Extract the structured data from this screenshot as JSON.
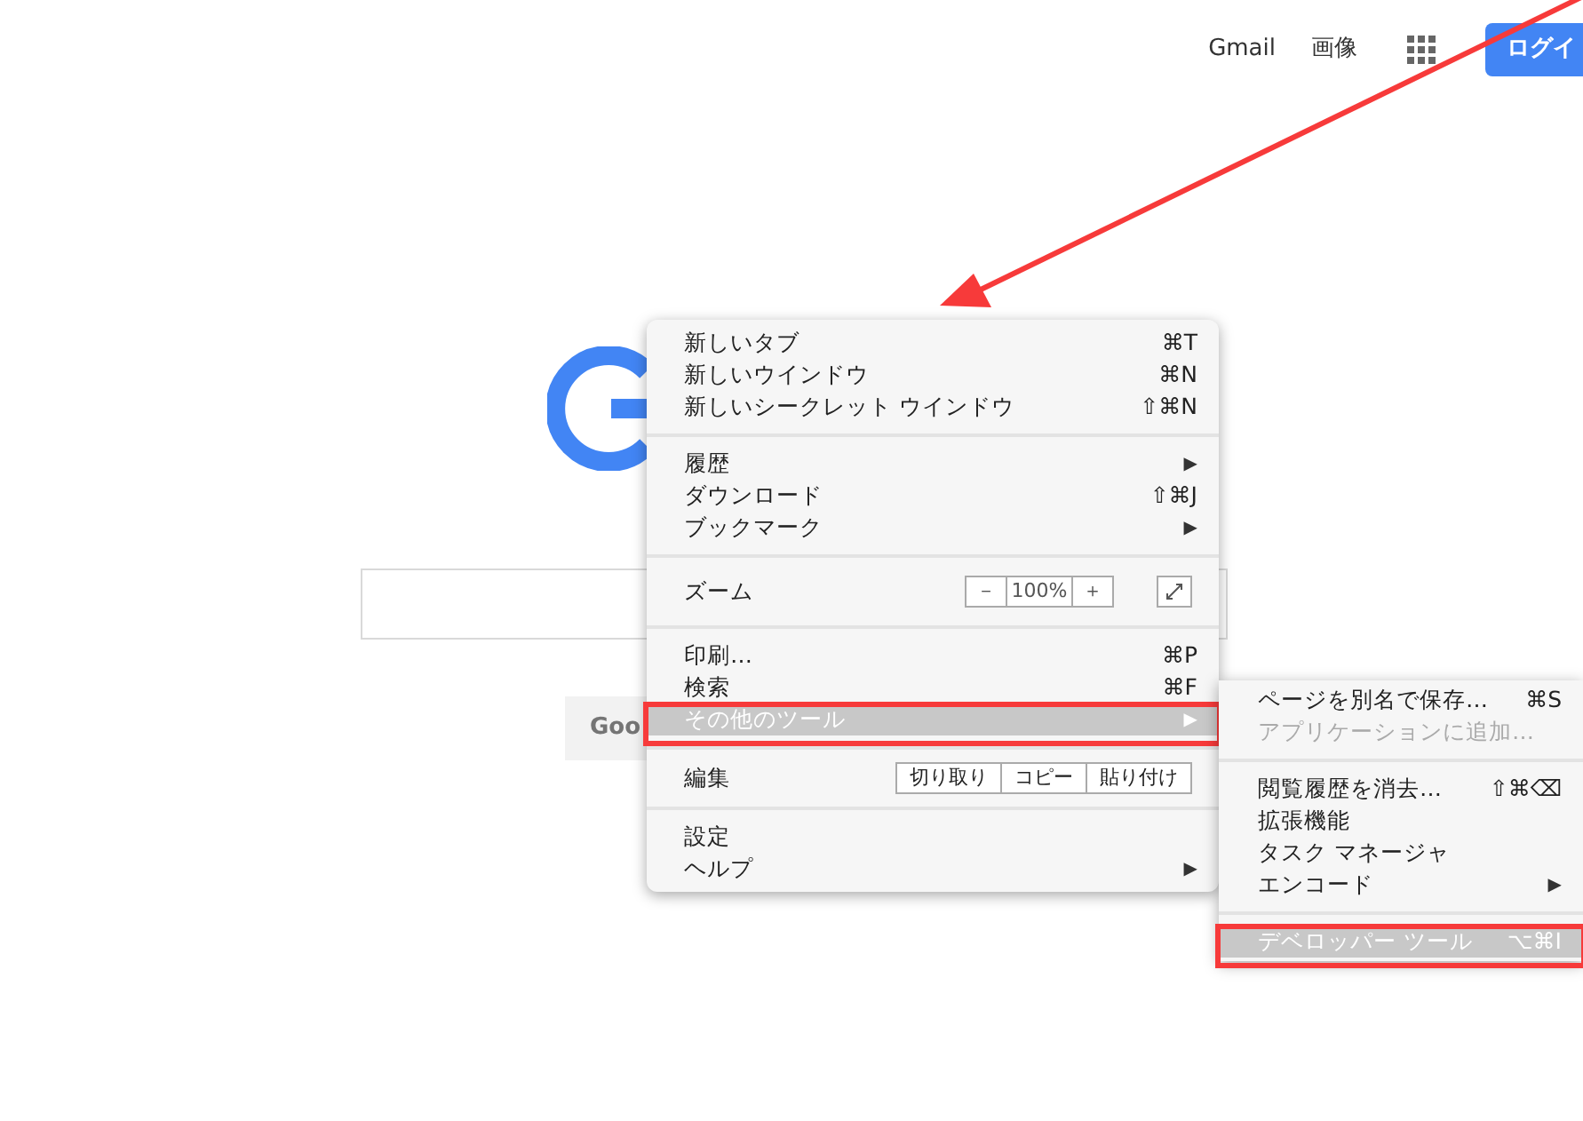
{
  "header": {
    "links": [
      "Gmail",
      "画像"
    ],
    "login_button": "ログイ"
  },
  "search": {
    "button": "Goo"
  },
  "menu": {
    "items": [
      {
        "kind": "item",
        "label": "新しいタブ",
        "shortcut": "⌘T",
        "selected": false
      },
      {
        "kind": "item",
        "label": "新しいウインドウ",
        "shortcut": "⌘N",
        "selected": false
      },
      {
        "kind": "item",
        "label": "新しいシークレット ウインドウ",
        "shortcut": "⇧⌘N",
        "selected": false
      },
      {
        "kind": "separator"
      },
      {
        "kind": "item",
        "label": "履歴",
        "arrow": "▶",
        "selected": false
      },
      {
        "kind": "item",
        "label": "ダウンロード",
        "shortcut": "⇧⌘J",
        "selected": false
      },
      {
        "kind": "item",
        "label": "ブックマーク",
        "arrow": "▶",
        "selected": false
      },
      {
        "kind": "separator"
      },
      {
        "kind": "zoom",
        "label": "ズーム",
        "minus": "－",
        "value": "100%",
        "plus": "＋"
      },
      {
        "kind": "separator"
      },
      {
        "kind": "item",
        "label": "印刷…",
        "shortcut": "⌘P",
        "selected": false
      },
      {
        "kind": "item",
        "label": "検索",
        "shortcut": "⌘F",
        "selected": false
      },
      {
        "kind": "item",
        "label": "その他のツール",
        "arrow": "▶",
        "selected": true
      },
      {
        "kind": "separator"
      },
      {
        "kind": "edit",
        "label": "編集",
        "buttons": [
          "切り取り",
          "コピー",
          "貼り付け"
        ]
      },
      {
        "kind": "separator"
      },
      {
        "kind": "item",
        "label": "設定",
        "selected": false
      },
      {
        "kind": "item",
        "label": "ヘルプ",
        "arrow": "▶",
        "selected": false
      }
    ]
  },
  "submenu": {
    "items": [
      {
        "kind": "item",
        "label": "ページを別名で保存…",
        "shortcut": "⌘S",
        "selected": false,
        "disabled": false
      },
      {
        "kind": "item",
        "label": "アプリケーションに追加…",
        "selected": false,
        "disabled": true
      },
      {
        "kind": "separator"
      },
      {
        "kind": "item",
        "label": "閲覧履歴を消去…",
        "shortcut": "⇧⌘⌫",
        "selected": false,
        "disabled": false
      },
      {
        "kind": "item",
        "label": "拡張機能",
        "selected": false,
        "disabled": false
      },
      {
        "kind": "item",
        "label": "タスク マネージャ",
        "selected": false,
        "disabled": false
      },
      {
        "kind": "item",
        "label": "エンコード",
        "arrow": "▶",
        "selected": false,
        "disabled": false
      },
      {
        "kind": "separator"
      },
      {
        "kind": "item",
        "label": "デベロッパー ツール",
        "shortcut": "⌥⌘I",
        "selected": true,
        "disabled": false
      }
    ]
  }
}
